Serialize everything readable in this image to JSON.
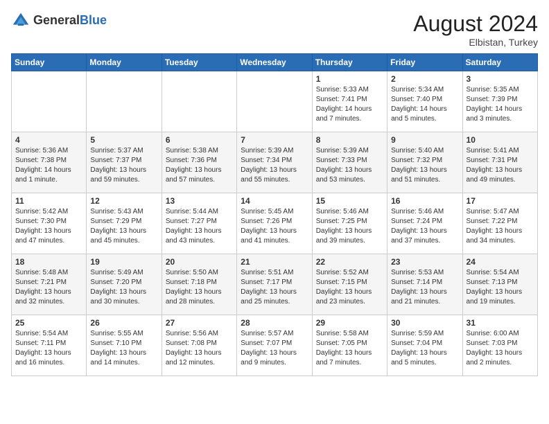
{
  "header": {
    "logo_general": "General",
    "logo_blue": "Blue",
    "month_year": "August 2024",
    "location": "Elbistan, Turkey"
  },
  "days_of_week": [
    "Sunday",
    "Monday",
    "Tuesday",
    "Wednesday",
    "Thursday",
    "Friday",
    "Saturday"
  ],
  "weeks": [
    [
      {
        "day": "",
        "info": ""
      },
      {
        "day": "",
        "info": ""
      },
      {
        "day": "",
        "info": ""
      },
      {
        "day": "",
        "info": ""
      },
      {
        "day": "1",
        "info": "Sunrise: 5:33 AM\nSunset: 7:41 PM\nDaylight: 14 hours\nand 7 minutes."
      },
      {
        "day": "2",
        "info": "Sunrise: 5:34 AM\nSunset: 7:40 PM\nDaylight: 14 hours\nand 5 minutes."
      },
      {
        "day": "3",
        "info": "Sunrise: 5:35 AM\nSunset: 7:39 PM\nDaylight: 14 hours\nand 3 minutes."
      }
    ],
    [
      {
        "day": "4",
        "info": "Sunrise: 5:36 AM\nSunset: 7:38 PM\nDaylight: 14 hours\nand 1 minute."
      },
      {
        "day": "5",
        "info": "Sunrise: 5:37 AM\nSunset: 7:37 PM\nDaylight: 13 hours\nand 59 minutes."
      },
      {
        "day": "6",
        "info": "Sunrise: 5:38 AM\nSunset: 7:36 PM\nDaylight: 13 hours\nand 57 minutes."
      },
      {
        "day": "7",
        "info": "Sunrise: 5:39 AM\nSunset: 7:34 PM\nDaylight: 13 hours\nand 55 minutes."
      },
      {
        "day": "8",
        "info": "Sunrise: 5:39 AM\nSunset: 7:33 PM\nDaylight: 13 hours\nand 53 minutes."
      },
      {
        "day": "9",
        "info": "Sunrise: 5:40 AM\nSunset: 7:32 PM\nDaylight: 13 hours\nand 51 minutes."
      },
      {
        "day": "10",
        "info": "Sunrise: 5:41 AM\nSunset: 7:31 PM\nDaylight: 13 hours\nand 49 minutes."
      }
    ],
    [
      {
        "day": "11",
        "info": "Sunrise: 5:42 AM\nSunset: 7:30 PM\nDaylight: 13 hours\nand 47 minutes."
      },
      {
        "day": "12",
        "info": "Sunrise: 5:43 AM\nSunset: 7:29 PM\nDaylight: 13 hours\nand 45 minutes."
      },
      {
        "day": "13",
        "info": "Sunrise: 5:44 AM\nSunset: 7:27 PM\nDaylight: 13 hours\nand 43 minutes."
      },
      {
        "day": "14",
        "info": "Sunrise: 5:45 AM\nSunset: 7:26 PM\nDaylight: 13 hours\nand 41 minutes."
      },
      {
        "day": "15",
        "info": "Sunrise: 5:46 AM\nSunset: 7:25 PM\nDaylight: 13 hours\nand 39 minutes."
      },
      {
        "day": "16",
        "info": "Sunrise: 5:46 AM\nSunset: 7:24 PM\nDaylight: 13 hours\nand 37 minutes."
      },
      {
        "day": "17",
        "info": "Sunrise: 5:47 AM\nSunset: 7:22 PM\nDaylight: 13 hours\nand 34 minutes."
      }
    ],
    [
      {
        "day": "18",
        "info": "Sunrise: 5:48 AM\nSunset: 7:21 PM\nDaylight: 13 hours\nand 32 minutes."
      },
      {
        "day": "19",
        "info": "Sunrise: 5:49 AM\nSunset: 7:20 PM\nDaylight: 13 hours\nand 30 minutes."
      },
      {
        "day": "20",
        "info": "Sunrise: 5:50 AM\nSunset: 7:18 PM\nDaylight: 13 hours\nand 28 minutes."
      },
      {
        "day": "21",
        "info": "Sunrise: 5:51 AM\nSunset: 7:17 PM\nDaylight: 13 hours\nand 25 minutes."
      },
      {
        "day": "22",
        "info": "Sunrise: 5:52 AM\nSunset: 7:15 PM\nDaylight: 13 hours\nand 23 minutes."
      },
      {
        "day": "23",
        "info": "Sunrise: 5:53 AM\nSunset: 7:14 PM\nDaylight: 13 hours\nand 21 minutes."
      },
      {
        "day": "24",
        "info": "Sunrise: 5:54 AM\nSunset: 7:13 PM\nDaylight: 13 hours\nand 19 minutes."
      }
    ],
    [
      {
        "day": "25",
        "info": "Sunrise: 5:54 AM\nSunset: 7:11 PM\nDaylight: 13 hours\nand 16 minutes."
      },
      {
        "day": "26",
        "info": "Sunrise: 5:55 AM\nSunset: 7:10 PM\nDaylight: 13 hours\nand 14 minutes."
      },
      {
        "day": "27",
        "info": "Sunrise: 5:56 AM\nSunset: 7:08 PM\nDaylight: 13 hours\nand 12 minutes."
      },
      {
        "day": "28",
        "info": "Sunrise: 5:57 AM\nSunset: 7:07 PM\nDaylight: 13 hours\nand 9 minutes."
      },
      {
        "day": "29",
        "info": "Sunrise: 5:58 AM\nSunset: 7:05 PM\nDaylight: 13 hours\nand 7 minutes."
      },
      {
        "day": "30",
        "info": "Sunrise: 5:59 AM\nSunset: 7:04 PM\nDaylight: 13 hours\nand 5 minutes."
      },
      {
        "day": "31",
        "info": "Sunrise: 6:00 AM\nSunset: 7:03 PM\nDaylight: 13 hours\nand 2 minutes."
      }
    ]
  ]
}
